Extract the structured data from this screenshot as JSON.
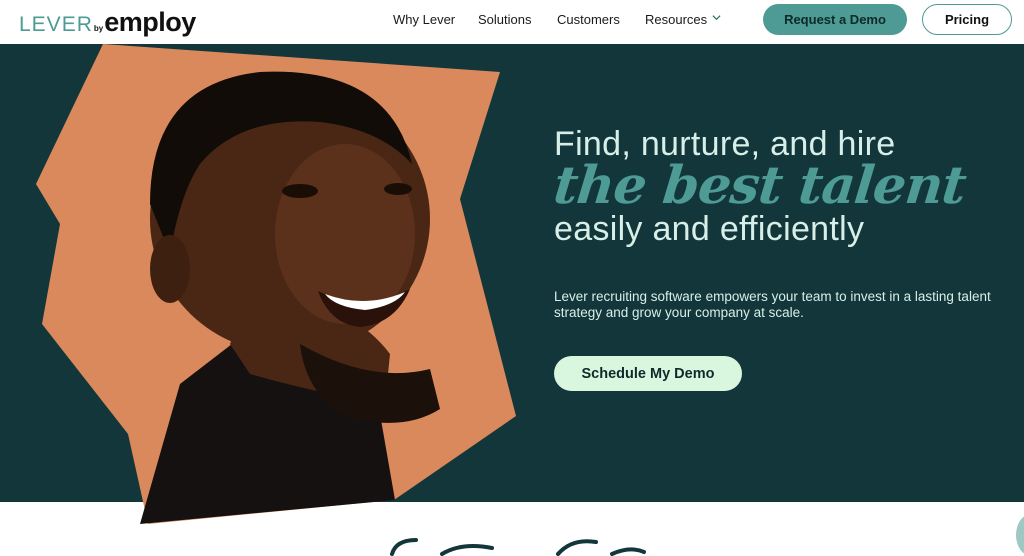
{
  "brand": {
    "logo_primary": "LEVER",
    "logo_by": "by",
    "logo_secondary": "employ"
  },
  "nav": {
    "items": [
      "Why Lever",
      "Solutions",
      "Customers",
      "Resources"
    ],
    "request_demo": "Request a Demo",
    "pricing": "Pricing"
  },
  "hero": {
    "headline_line1": "Find, nurture, and hire",
    "headline_line2": "the best talent",
    "headline_line3": "easily and efficiently",
    "subtext": "Lever recruiting software empowers your team to invest in a lasting talent strategy and grow your company at scale.",
    "cta": "Schedule My Demo"
  },
  "colors": {
    "teal": "#4e9a94",
    "hero_bg": "#12363a",
    "hero_text": "#d7efe8",
    "cta_bg": "#d9f7df",
    "photo_bg": "#d9895b"
  },
  "icons": {
    "resources_dropdown": "chevron-down-icon"
  }
}
